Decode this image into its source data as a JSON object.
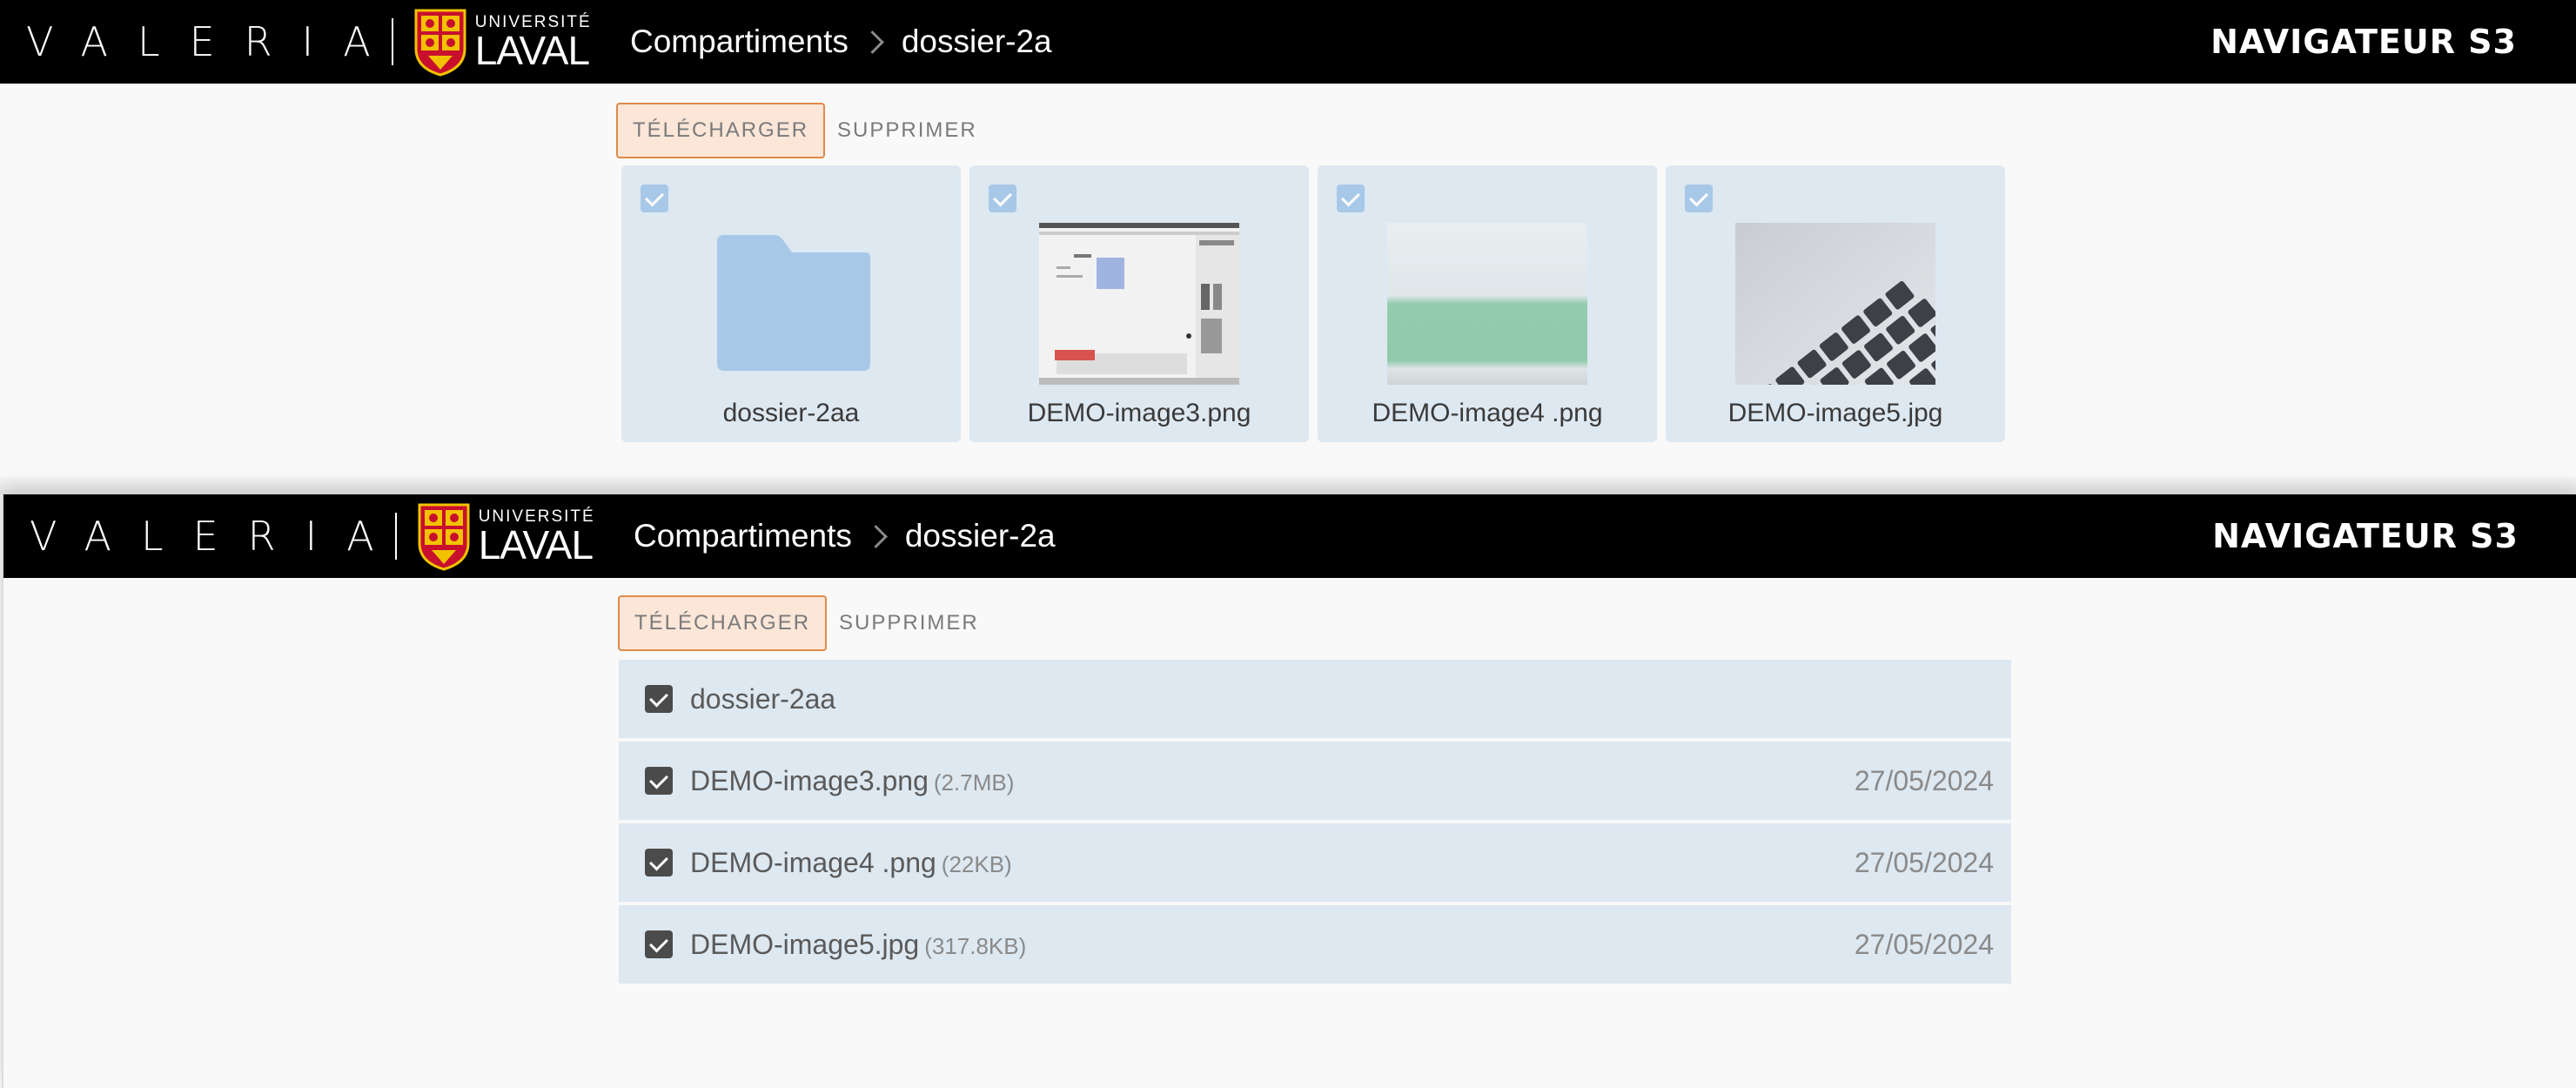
{
  "header": {
    "brand": "VALERIA",
    "university_top": "UNIVERSITÉ",
    "university_bottom": "LAVAL",
    "breadcrumb": [
      "Compartiments",
      "dossier-2a"
    ],
    "app_title": "NAVIGATEUR S3"
  },
  "toolbar": {
    "download_label": "TÉLÉCHARGER",
    "delete_label": "SUPPRIMER"
  },
  "grid_items": [
    {
      "name": "dossier-2aa",
      "kind": "folder",
      "icon": "folder-icon",
      "checked": true
    },
    {
      "name": "DEMO-image3.png",
      "kind": "image",
      "icon": "screenshot-thumbnail",
      "checked": true
    },
    {
      "name": "DEMO-image4 .png",
      "kind": "image",
      "icon": "green-band-thumbnail",
      "checked": true
    },
    {
      "name": "DEMO-image5.jpg",
      "kind": "image",
      "icon": "keyboard-photo-thumbnail",
      "checked": true
    }
  ],
  "list_items": [
    {
      "name": "dossier-2aa",
      "size": "",
      "date": "",
      "checked": true
    },
    {
      "name": "DEMO-image3.png",
      "size": "(2.7MB)",
      "date": "27/05/2024",
      "checked": true
    },
    {
      "name": "DEMO-image4 .png",
      "size": "(22KB)",
      "date": "27/05/2024",
      "checked": true
    },
    {
      "name": "DEMO-image5.jpg",
      "size": "(317.8KB)",
      "date": "27/05/2024",
      "checked": true
    }
  ],
  "colors": {
    "header_bg": "#000000",
    "accent": "#e08a4a",
    "card_bg": "#dde8f1",
    "folder": "#a8c8e8"
  }
}
